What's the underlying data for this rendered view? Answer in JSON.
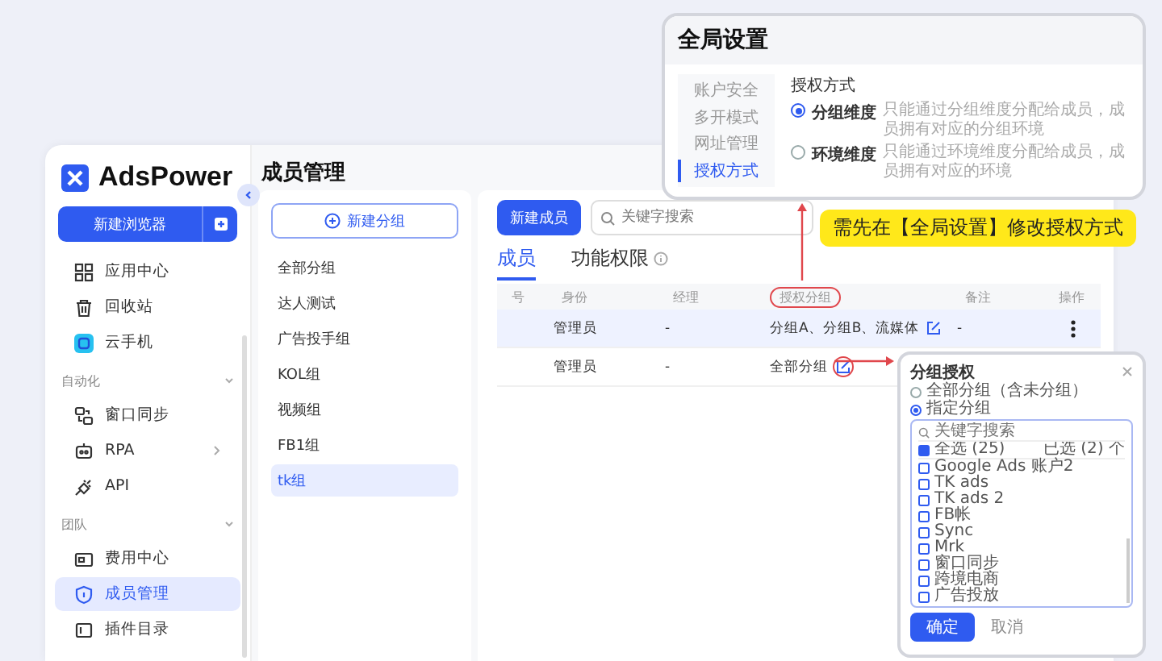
{
  "app": {
    "logo": "AdsPower",
    "new_browser_button": "新建浏览器"
  },
  "sidebar": {
    "items": [
      {
        "kind": "item",
        "label": "应用中心",
        "selected": false,
        "has_submenu": false
      },
      {
        "kind": "item",
        "label": "回收站",
        "selected": false,
        "has_submenu": false
      },
      {
        "kind": "item",
        "label": "云手机",
        "selected": false,
        "has_submenu": false
      },
      {
        "kind": "section",
        "label": "自动化",
        "expanded": true
      },
      {
        "kind": "item",
        "label": "窗口同步",
        "selected": false,
        "has_submenu": false
      },
      {
        "kind": "item",
        "label": "RPA",
        "selected": false,
        "has_submenu": true
      },
      {
        "kind": "item",
        "label": "API",
        "selected": false,
        "has_submenu": false
      },
      {
        "kind": "section",
        "label": "团队",
        "expanded": true
      },
      {
        "kind": "item",
        "label": "费用中心",
        "selected": false,
        "has_submenu": false
      },
      {
        "kind": "item",
        "label": "成员管理",
        "selected": true,
        "has_submenu": false
      },
      {
        "kind": "item",
        "label": "插件目录",
        "selected": false,
        "has_submenu": false
      }
    ]
  },
  "page_title": "成员管理",
  "groups": {
    "new_group_button": "新建分组",
    "items": [
      {
        "label": "全部分组",
        "selected": false
      },
      {
        "label": "达人测试",
        "selected": false
      },
      {
        "label": "广告投手组",
        "selected": false
      },
      {
        "label": "KOL组",
        "selected": false
      },
      {
        "label": "视频组",
        "selected": false
      },
      {
        "label": "FB1组",
        "selected": false
      },
      {
        "label": "tk组",
        "selected": true
      }
    ]
  },
  "members": {
    "new_member_button": "新建成员",
    "search": {
      "placeholder": "关键字搜索"
    },
    "tabs": [
      {
        "label": "成员",
        "selected": true,
        "info": false
      },
      {
        "label": "功能权限",
        "selected": false,
        "info": true
      }
    ],
    "table": {
      "columns": [
        {
          "label": "号",
          "highlighted": false
        },
        {
          "label": "身份",
          "highlighted": false
        },
        {
          "label": "经理",
          "highlighted": false
        },
        {
          "label": "授权分组",
          "highlighted": true
        },
        {
          "label": "备注",
          "highlighted": false
        },
        {
          "label": "操作",
          "highlighted": false
        }
      ],
      "rows": [
        {
          "role": "管理员",
          "manager": "-",
          "groups": "分组A、分组B、流媒体",
          "note": "-",
          "selected": true,
          "edit_highlighted": false
        },
        {
          "role": "管理员",
          "manager": "-",
          "groups": "全部分组",
          "selected": false,
          "edit_highlighted": true
        }
      ]
    }
  },
  "global_settings": {
    "title": "全局设置",
    "nav": [
      {
        "label": "账户安全",
        "selected": false
      },
      {
        "label": "多开模式",
        "selected": false
      },
      {
        "label": "网址管理",
        "selected": false
      },
      {
        "label": "授权方式",
        "selected": true
      }
    ],
    "section_title": "授权方式",
    "options": [
      {
        "label": "分组维度",
        "description": "只能通过分组维度分配给成员，成员拥有对应的分组环境",
        "selected": true
      },
      {
        "label": "环境维度",
        "description": "只能通过环境维度分配给成员，成员拥有对应的环境",
        "selected": false
      }
    ]
  },
  "callout": "需先在【全局设置】修改授权方式",
  "group_auth_dialog": {
    "title": "分组授权",
    "scopes": [
      {
        "label": "全部分组（含未分组）",
        "selected": false
      },
      {
        "label": "指定分组",
        "selected": true
      }
    ],
    "search": {
      "placeholder": "关键字搜索"
    },
    "select_all": {
      "label": "全选 (25)",
      "checked": true
    },
    "selected_count": "已选 (2) 个",
    "items": [
      {
        "label": "Google Ads 账户2",
        "checked": false
      },
      {
        "label": "TK ads",
        "checked": false
      },
      {
        "label": "TK ads 2",
        "checked": false
      },
      {
        "label": "FB帐",
        "checked": false
      },
      {
        "label": "Sync",
        "checked": false
      },
      {
        "label": "Mrk",
        "checked": false
      },
      {
        "label": "窗口同步",
        "checked": false
      },
      {
        "label": "跨境电商",
        "checked": false
      },
      {
        "label": "广告投放",
        "checked": false
      }
    ],
    "confirm_button": "确定",
    "cancel_button": "取消"
  }
}
